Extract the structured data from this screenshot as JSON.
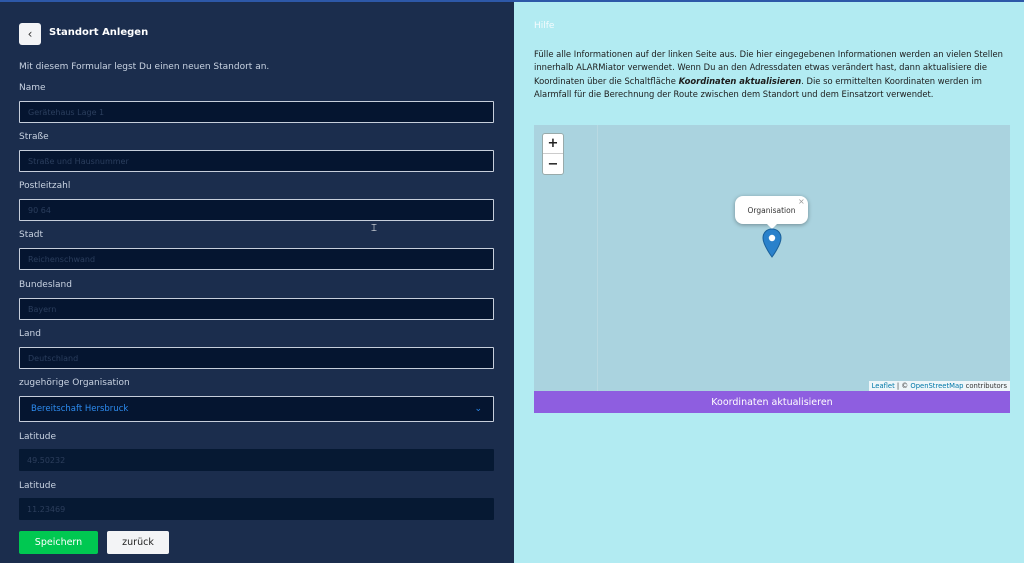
{
  "header": {
    "title": "Standort Anlegen",
    "back_icon": "chevron-left-icon"
  },
  "intro": "Mit diesem Formular legst Du einen neuen Standort an.",
  "fields": {
    "name": {
      "label": "Name",
      "value": "Gerätehaus Lage 1"
    },
    "strasse": {
      "label": "Straße",
      "placeholder": "Straße und Hausnummer"
    },
    "plz": {
      "label": "Postleitzahl",
      "value": "90 64"
    },
    "stadt": {
      "label": "Stadt",
      "value": "Reichenschwand"
    },
    "bundesland": {
      "label": "Bundesland",
      "value": "Bayern"
    },
    "land": {
      "label": "Land",
      "value": "Deutschland"
    },
    "organisation": {
      "label": "zugehörige Organisation",
      "value": "Bereitschaft Hersbruck"
    },
    "latitude": {
      "label": "Latitude",
      "value": "49.50232"
    },
    "longitude": {
      "label": "Latitude",
      "value": "11.23469"
    }
  },
  "buttons": {
    "save": "Speichern",
    "back": "zurück"
  },
  "help": {
    "title": "Hilfe",
    "text_part1": "Fülle alle Informationen auf der linken Seite aus. Die hier eingegebenen Informationen werden an vielen Stellen innerhalb ALARMiator verwendet. Wenn Du an den Adressdaten etwas verändert hast, dann aktualisiere die Koordinaten über die Schaltfläche ",
    "text_bold": "Koordinaten aktualisieren",
    "text_part2": ". Die so ermittelten Koordinaten werden im Alarmfall für die Berechnung der Route zwischen dem Standort und dem Einsatzort verwendet."
  },
  "map": {
    "zoom_in": "+",
    "zoom_out": "−",
    "popup_label": "Organisation",
    "popup_close": "×",
    "attribution": {
      "leaflet": "Leaflet",
      "sep": " | © ",
      "osm": "OpenStreetMap",
      "suffix": " contributors"
    },
    "marker_color": "#2a81cb"
  },
  "coord_button": "Koordinaten aktualisieren",
  "colors": {
    "left_bg": "#1b2d4d",
    "right_bg": "#b2ebf2",
    "save": "#00c851",
    "coord": "#8e5ee0"
  }
}
